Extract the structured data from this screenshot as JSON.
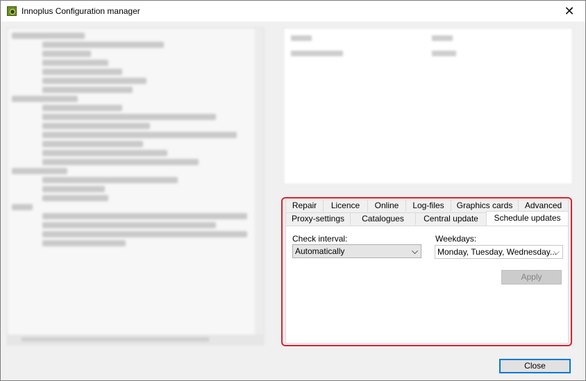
{
  "window": {
    "title": "Innoplus Configuration manager",
    "close_glyph": "✕"
  },
  "tabs": {
    "row_back": [
      "Repair",
      "Licence",
      "Online",
      "Log-files",
      "Graphics cards",
      "Advanced"
    ],
    "row_front": [
      "Proxy-settings",
      "Catalogues",
      "Central update",
      "Schedule updates"
    ],
    "selected": "Schedule updates"
  },
  "schedule": {
    "check_interval_label": "Check interval:",
    "check_interval_value": "Automatically",
    "weekdays_label": "Weekdays:",
    "weekdays_value": "Monday, Tuesday, Wednesday...",
    "apply_label": "Apply"
  },
  "footer": {
    "close_label": "Close"
  },
  "colors": {
    "highlight": "#e0202c",
    "focus": "#0078d7"
  },
  "icons": {
    "app": "app-gear-icon",
    "close": "close-icon",
    "dropdown": "chevron-down-icon"
  }
}
